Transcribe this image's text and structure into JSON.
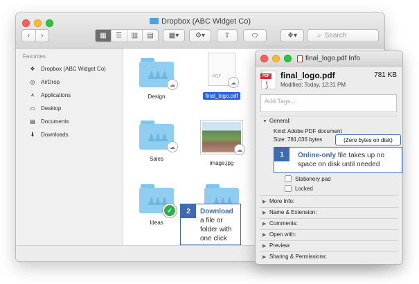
{
  "finder": {
    "window_title": "Dropbox (ABC Widget Co)",
    "search_placeholder": "Search",
    "sidebar": {
      "header": "Favorites",
      "items": [
        {
          "label": "Dropbox (ABC Widget Co)",
          "icon": "dropbox-icon"
        },
        {
          "label": "AirDrop",
          "icon": "airdrop-icon"
        },
        {
          "label": "Applications",
          "icon": "applications-icon"
        },
        {
          "label": "Desktop",
          "icon": "desktop-icon"
        },
        {
          "label": "Documents",
          "icon": "documents-icon"
        },
        {
          "label": "Downloads",
          "icon": "downloads-icon"
        }
      ]
    },
    "files": {
      "design": "Design",
      "final_logo": "final_logo.pdf",
      "sales": "Sales",
      "image": "image.jpg",
      "ideas": "Ideas",
      "pdf_ext": "PDF"
    }
  },
  "info_window": {
    "title": "final_logo.pdf Info",
    "file_name": "final_logo.pdf",
    "file_size": "781 KB",
    "modified": "Modified: Today, 12:31 PM",
    "tags_placeholder": "Add Tags...",
    "general_label": "General:",
    "kind": "Kind: Adobe PDF document",
    "size": "Size: 781,036 bytes",
    "stationery": "Stationery pad",
    "locked": "Locked",
    "sections": [
      "More Info:",
      "Name & Extension:",
      "Comments:",
      "Open with:",
      "Preview:",
      "Sharing & Permissions:"
    ]
  },
  "callouts": {
    "zero_bytes": "(Zero bytes on disk)",
    "one_num": "1",
    "one_bold": "Online-only",
    "one_rest": " file takes up no space on disk until needed",
    "two_num": "2",
    "two_bold": "Download",
    "two_rest": "a file or folder with one click"
  },
  "colors": {
    "accent": "#3d6bb3",
    "selection": "#2962d9",
    "folder": "#8fcef0",
    "online": "#2fae4c"
  }
}
